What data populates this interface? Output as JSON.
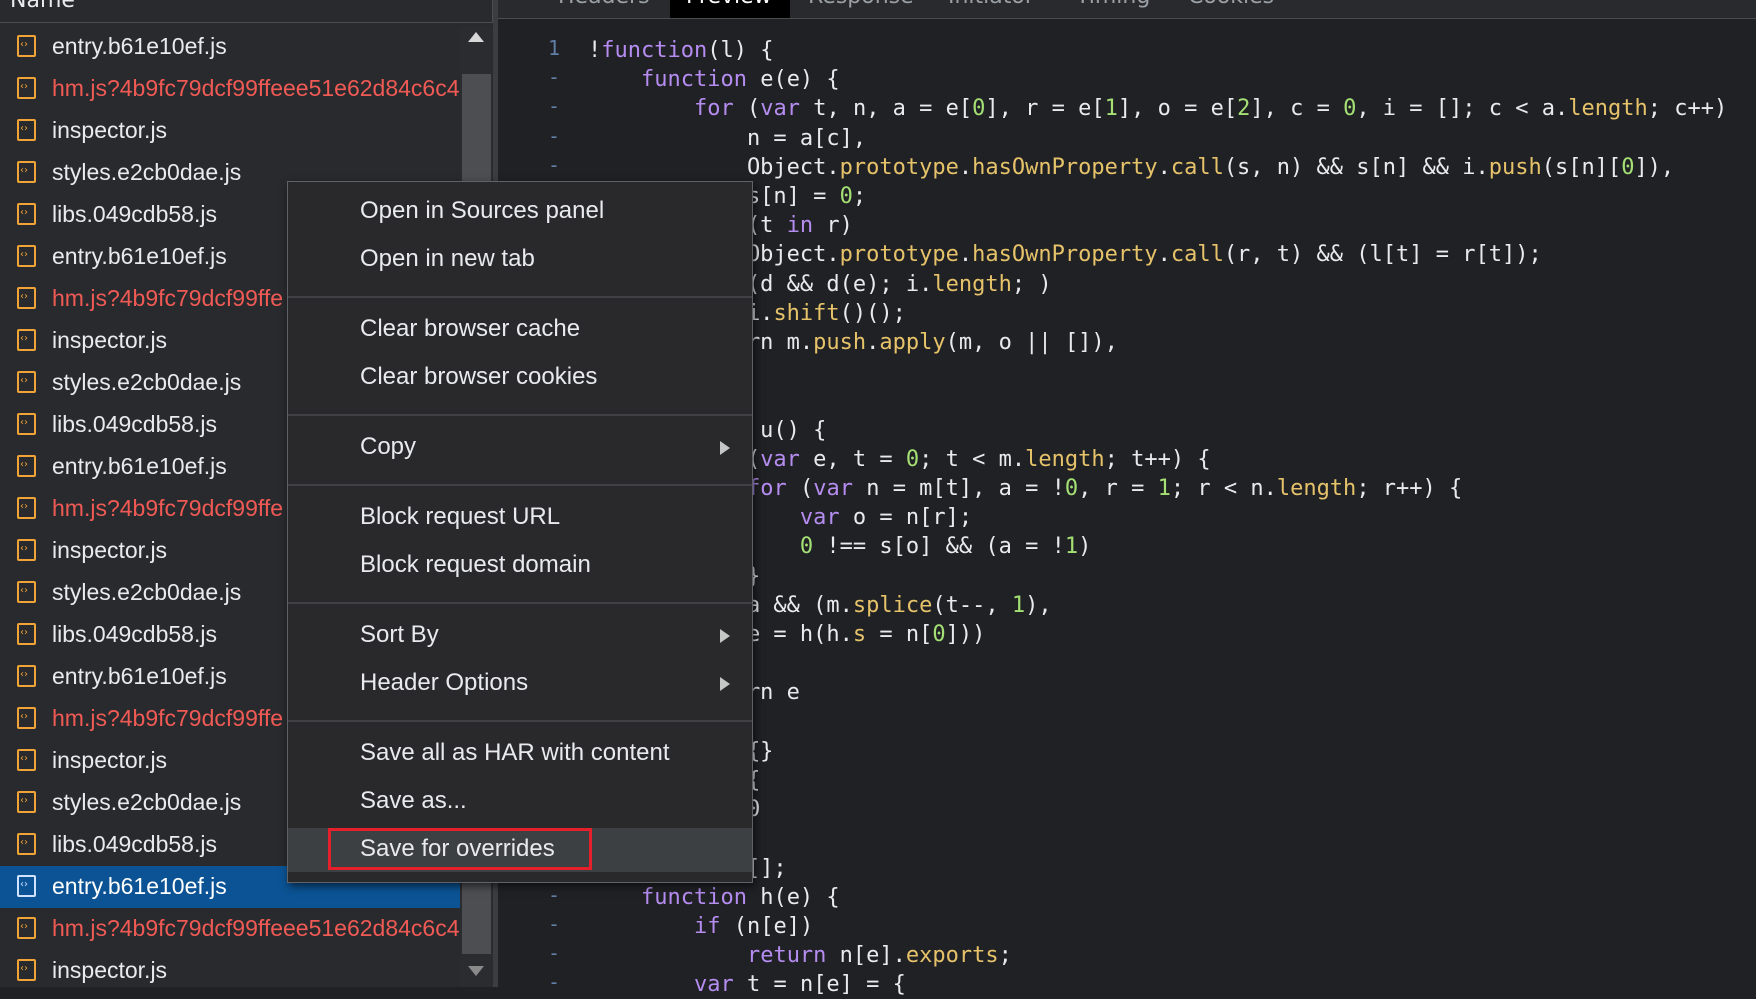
{
  "list": {
    "header": "Name",
    "rows": [
      {
        "name": "entry.b61e10ef.js",
        "status": "ok"
      },
      {
        "name": "hm.js?4b9fc79dcf99ffeee51e62d84c6c4",
        "status": "error"
      },
      {
        "name": "inspector.js",
        "status": "ok"
      },
      {
        "name": "styles.e2cb0dae.js",
        "status": "ok"
      },
      {
        "name": "libs.049cdb58.js",
        "status": "ok"
      },
      {
        "name": "entry.b61e10ef.js",
        "status": "ok"
      },
      {
        "name": "hm.js?4b9fc79dcf99ffe",
        "status": "error"
      },
      {
        "name": "inspector.js",
        "status": "ok"
      },
      {
        "name": "styles.e2cb0dae.js",
        "status": "ok"
      },
      {
        "name": "libs.049cdb58.js",
        "status": "ok"
      },
      {
        "name": "entry.b61e10ef.js",
        "status": "ok"
      },
      {
        "name": "hm.js?4b9fc79dcf99ffe",
        "status": "error"
      },
      {
        "name": "inspector.js",
        "status": "ok"
      },
      {
        "name": "styles.e2cb0dae.js",
        "status": "ok"
      },
      {
        "name": "libs.049cdb58.js",
        "status": "ok"
      },
      {
        "name": "entry.b61e10ef.js",
        "status": "ok"
      },
      {
        "name": "hm.js?4b9fc79dcf99ffe",
        "status": "error"
      },
      {
        "name": "inspector.js",
        "status": "ok"
      },
      {
        "name": "styles.e2cb0dae.js",
        "status": "ok"
      },
      {
        "name": "libs.049cdb58.js",
        "status": "ok"
      },
      {
        "name": "entry.b61e10ef.js",
        "status": "selected"
      },
      {
        "name": "hm.js?4b9fc79dcf99ffeee51e62d84c6c4",
        "status": "error"
      },
      {
        "name": "inspector.js",
        "status": "ok"
      }
    ]
  },
  "tabs": [
    "Headers",
    "Preview",
    "Response",
    "Initiator",
    "Timing",
    "Cookies"
  ],
  "active_tab": "Preview",
  "code": {
    "line_numbers": [
      "1",
      "-",
      "-",
      "-",
      "-",
      "-",
      "-",
      "-",
      "-",
      "-",
      "-",
      "-",
      "-",
      "-",
      "-",
      "-",
      "-",
      "-",
      "-",
      "-",
      "-",
      "-",
      "-",
      "-",
      "-",
      "-",
      "-",
      "-",
      "-",
      "-",
      "-",
      "-",
      "-"
    ],
    "lines": [
      "!function(l) {",
      "    function e(e) {",
      "        for (var t, n, a = e[0], r = e[1], o = e[2], c = 0, i = []; c < a.length; c++)",
      "            n = a[c],",
      "            Object.prototype.hasOwnProperty.call(s, n) && s[n] && i.push(s[n][0]),",
      "            s[n] = 0;",
      "            (t in r)",
      "            Object.prototype.hasOwnProperty.call(r, t) && (l[t] = r[t]);",
      "            (d && d(e); i.length; )",
      "            i.shift()();",
      "            rn m.push.apply(m, o || []),",
      "",
      "",
      "             u() {",
      "            (var e, t = 0; t < m.length; t++) {",
      "            for (var n = m[t], a = !0, r = 1; r < n.length; r++) {",
      "                var o = n[r];",
      "                0 !== s[o] && (a = !1)",
      "            }",
      "            a && (m.splice(t--, 1),",
      "            e = h(h.s = n[0]))",
      "",
      "            rn e",
      "",
      "            {}",
      "            {",
      "            0",
      "",
      "            [];",
      "    function h(e) {",
      "        if (n[e])",
      "            return n[e].exports;",
      "        var t = n[e] = {"
    ]
  },
  "menu": {
    "items": [
      {
        "label": "Open in Sources panel"
      },
      {
        "label": "Open in new tab"
      },
      {
        "label": "Clear browser cache"
      },
      {
        "label": "Clear browser cookies"
      },
      {
        "label": "Copy"
      },
      {
        "label": "Block request URL"
      },
      {
        "label": "Block request domain"
      },
      {
        "label": "Sort By"
      },
      {
        "label": "Header Options"
      },
      {
        "label": "Save all as HAR with content"
      },
      {
        "label": "Save as..."
      },
      {
        "label": "Save for overrides"
      }
    ]
  }
}
